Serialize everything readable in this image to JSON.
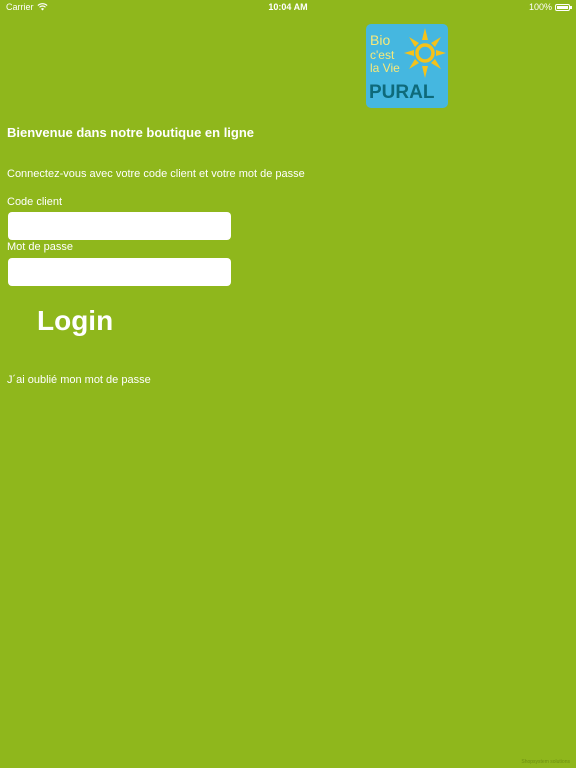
{
  "status_bar": {
    "carrier": "Carrier",
    "time": "10:04 AM",
    "battery": "100%"
  },
  "logo": {
    "line1": "Bio",
    "line2": "c'est",
    "line3": "la Vie",
    "brand": "PURAL",
    "colors": {
      "background": "#45b7e0",
      "sun": "#f4c21a",
      "text": "#f7e97a",
      "brand": "#0e6a7a"
    }
  },
  "welcome": {
    "title": "Bienvenue dans notre boutique en ligne",
    "instructions": "Connectez-vous avec votre code client et votre mot de passe"
  },
  "form": {
    "client_code_label": "Code client",
    "client_code_value": "",
    "password_label": "Mot de passe",
    "password_value": "",
    "login_label": "Login",
    "forgot_label": "J´ai oublié mon mot de passe"
  },
  "footer": {
    "credit": "Shopsystem solutions"
  },
  "theme": {
    "background": "#8fb71c",
    "text": "#ffffff"
  }
}
